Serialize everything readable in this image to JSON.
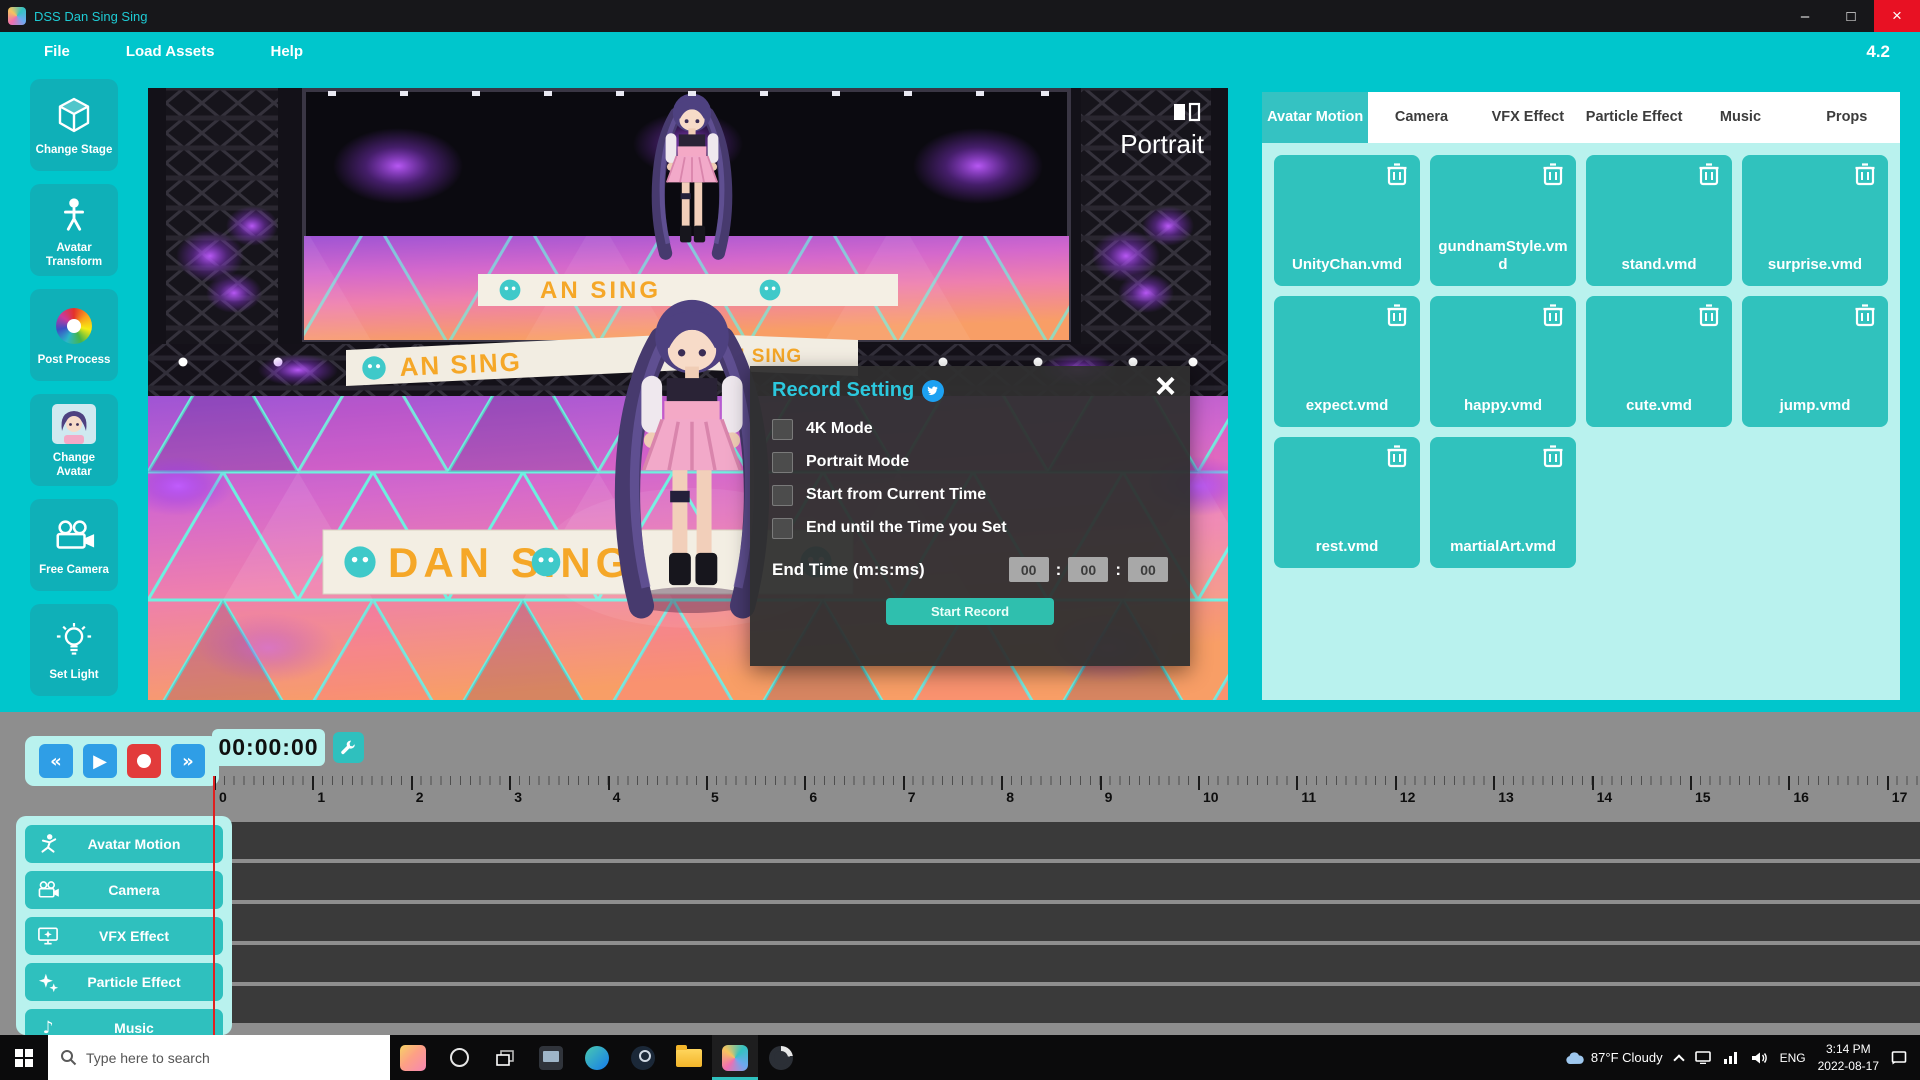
{
  "colors": {
    "cyan": "#00c6cc",
    "teal_button": "#0fb0b8",
    "teal_card": "#30c2bd",
    "pale_panel": "#b9f2ee",
    "dialog_bg": "#2f2f2f",
    "record_red": "#e23b3b",
    "accent_title": "#1ecbd4",
    "banner_orange": "#f5a728"
  },
  "titlebar": {
    "title": "DSS Dan Sing Sing"
  },
  "menubar": {
    "items": [
      "File",
      "Load Assets",
      "Help"
    ],
    "version": "4.2"
  },
  "sidebar": {
    "buttons": [
      "Change Stage",
      "Avatar Transform",
      "Post Process",
      "Change Avatar",
      "Free Camera",
      "Set Light"
    ]
  },
  "viewport": {
    "portrait_label": "Portrait",
    "banner_text": "DAN SING",
    "banner_text_partial": "AN SING"
  },
  "record_dialog": {
    "title": "Record Setting",
    "options": [
      "4K Mode",
      "Portrait Mode",
      "Start from Current Time",
      "End until the Time you Set"
    ],
    "end_time_label": "End Time (m:s:ms)",
    "time_fields": [
      "00",
      "00",
      "00"
    ],
    "start_button_label": "Start Record"
  },
  "right_panel": {
    "tabs": [
      {
        "label": "Avatar Motion",
        "active": true
      },
      {
        "label": "Camera",
        "active": false
      },
      {
        "label": "VFX Effect",
        "active": false
      },
      {
        "label": "Particle Effect",
        "active": false
      },
      {
        "label": "Music",
        "active": false
      },
      {
        "label": "Props",
        "active": false
      }
    ],
    "motion_files": [
      "UnityChan.vmd",
      "gundnamStyle.vmd",
      "stand.vmd",
      "surprise.vmd",
      "expect.vmd",
      "happy.vmd",
      "cute.vmd",
      "jump.vmd",
      "rest.vmd",
      "martialArt.vmd"
    ]
  },
  "timeline": {
    "time_display": "00:00:00",
    "ruler_numbers": [
      "0",
      "1",
      "2",
      "3",
      "4",
      "5",
      "6",
      "7",
      "8",
      "9",
      "10",
      "11",
      "12",
      "13",
      "14",
      "15",
      "16",
      "17"
    ],
    "track_count": 5
  },
  "bottom_nav": {
    "buttons": [
      "Avatar Motion",
      "Camera",
      "VFX Effect",
      "Particle Effect",
      "Music"
    ]
  },
  "taskbar": {
    "search_placeholder": "Type here to search",
    "tray": {
      "weather": "87°F Cloudy",
      "language": "ENG",
      "time": "3:14 PM",
      "date": "2022-08-17"
    }
  }
}
